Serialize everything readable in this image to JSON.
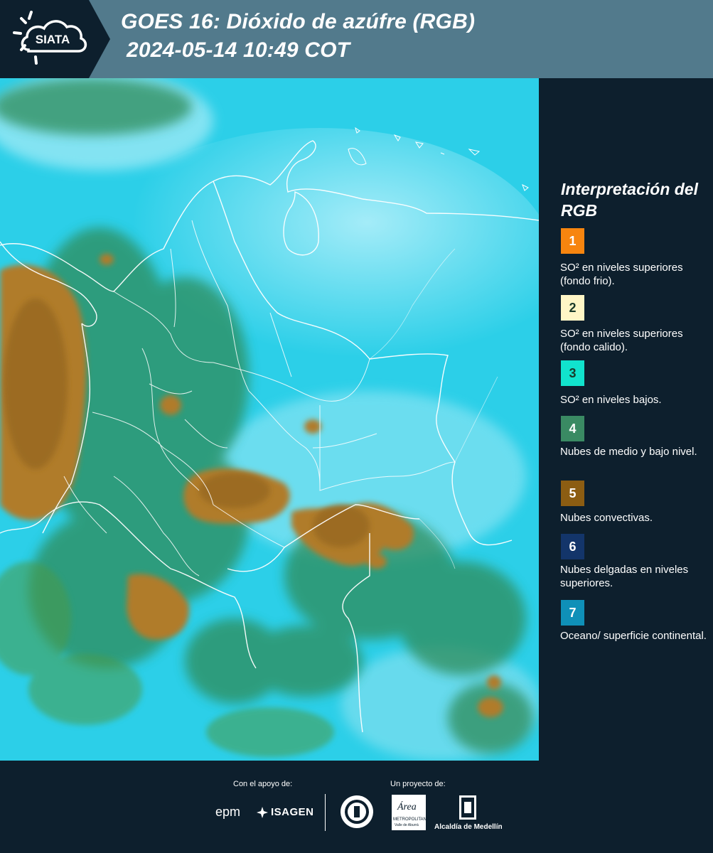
{
  "header": {
    "logo_text": "SIATA",
    "title_line1": "GOES 16: Dióxido de azúfre (RGB)",
    "title_line2": "2024-05-14 10:49 COT"
  },
  "legend": {
    "title": "Interpretación del RGB",
    "items": [
      {
        "number": "1",
        "color": "#f7850f",
        "text": "SO² en niveles superiores (fondo frio)."
      },
      {
        "number": "2",
        "color": "#fff6c6",
        "text": "SO² en niveles superiores (fondo calido)."
      },
      {
        "number": "3",
        "color": "#11e3cd",
        "text": "SO² en niveles bajos."
      },
      {
        "number": "4",
        "color": "#3a8a63",
        "text": "Nubes de medio y bajo nivel."
      },
      {
        "number": "5",
        "color": "#8c5d12",
        "text": "Nubes convectivas."
      },
      {
        "number": "6",
        "color": "#13356a",
        "text": "Nubes delgadas en niveles superiores."
      },
      {
        "number": "7",
        "color": "#0f90b8",
        "text": "Oceano/ superficie continental."
      }
    ]
  },
  "footer": {
    "support_label": "Con el apoyo de:",
    "project_label": "Un proyecto de:",
    "sponsors": [
      "epm",
      "ISAGEN"
    ],
    "area_name": "Área",
    "area_subtitle": "METROPOLITANA",
    "area_subtitle2": "Valle de Aburrá",
    "alcaldia": "Alcaldía de Medellín"
  },
  "colors": {
    "header_bg": "#527a8c",
    "panel_bg": "#0d1f2d",
    "ocean": "#2ccfe8",
    "convective": "#b07c2a",
    "low_cloud": "#2f8c5a"
  }
}
